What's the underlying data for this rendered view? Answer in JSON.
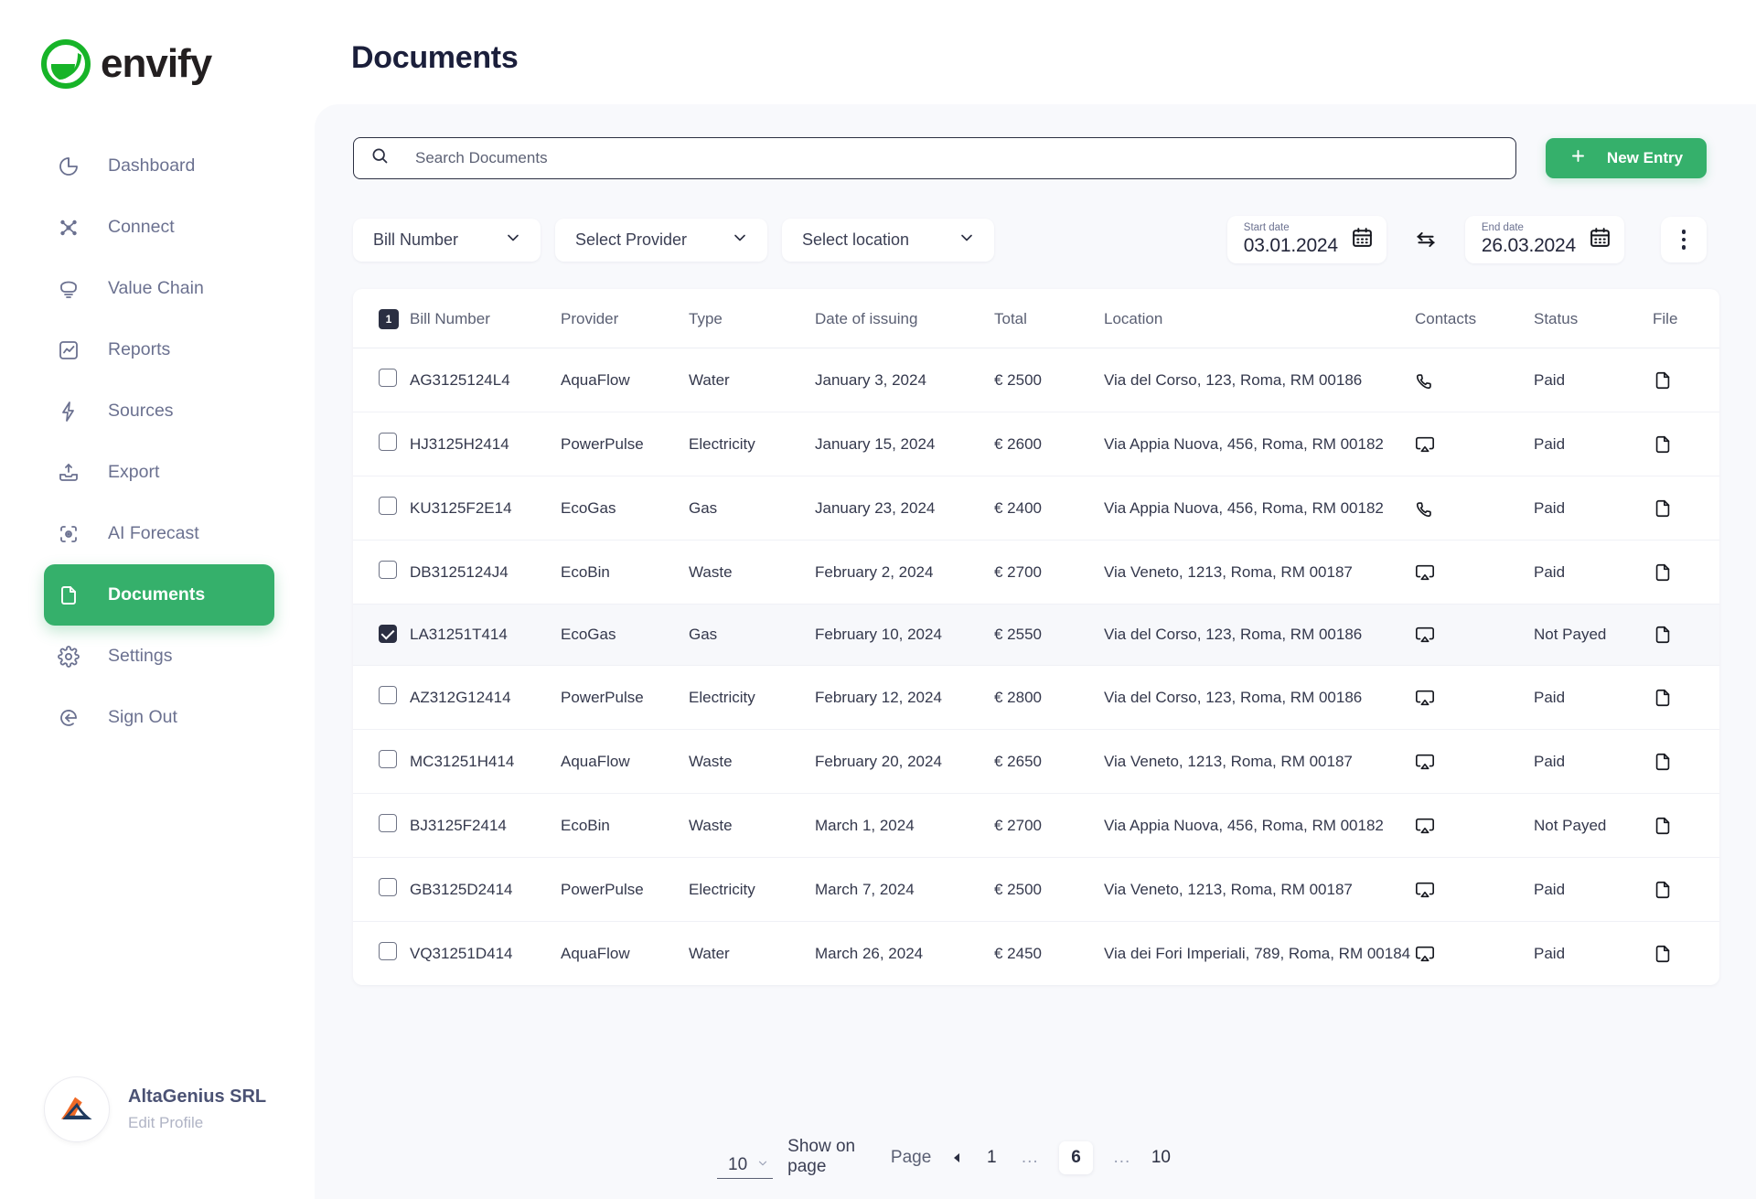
{
  "brand": {
    "name": "envify",
    "accent": "#35b06b"
  },
  "sidebar": {
    "items": [
      {
        "label": "Dashboard",
        "icon": "pie-chart-icon",
        "active": false
      },
      {
        "label": "Connect",
        "icon": "network-icon",
        "active": false
      },
      {
        "label": "Value Chain",
        "icon": "chain-link-icon",
        "active": false
      },
      {
        "label": "Reports",
        "icon": "report-icon",
        "active": false
      },
      {
        "label": "Sources",
        "icon": "bolt-icon",
        "active": false
      },
      {
        "label": "Export",
        "icon": "export-icon",
        "active": false
      },
      {
        "label": "AI Forecast",
        "icon": "scan-eye-icon",
        "active": false
      },
      {
        "label": "Documents",
        "icon": "document-icon",
        "active": true
      },
      {
        "label": "Settings",
        "icon": "gear-icon",
        "active": false
      },
      {
        "label": "Sign Out",
        "icon": "sign-out-icon",
        "active": false
      }
    ],
    "profile": {
      "name": "AltaGenius SRL",
      "link": "Edit Profile"
    }
  },
  "header": {
    "title": "Documents"
  },
  "search": {
    "placeholder": "Search Documents",
    "value": "",
    "icon": "search-icon"
  },
  "new_entry": {
    "label": "New Entry",
    "icon": "plus-icon"
  },
  "filters": {
    "bill_number": "Bill Number",
    "provider": "Select Provider",
    "location": "Select location",
    "start": {
      "label": "Start date",
      "value": "03.01.2024",
      "icon": "calendar-icon"
    },
    "end": {
      "label": "End date",
      "value": "26.03.2024",
      "icon": "calendar-icon"
    },
    "swap_icon": "swap-arrows-icon",
    "more_icon": "kebab-menu-icon"
  },
  "table": {
    "select_all_badge": "1",
    "columns": [
      "Bill Number",
      "Provider",
      "Type",
      "Date of issuing",
      "Total",
      "Location",
      "Contacts",
      "Status",
      "File"
    ],
    "rows": [
      {
        "checked": false,
        "bill": "AG3125124L4",
        "provider": "AquaFlow",
        "type": "Water",
        "date": "January 3, 2024",
        "total": "€ 2500",
        "location": "Via del Corso, 123, Roma, RM 00186",
        "contact_icon": "phone-icon",
        "status": "Paid",
        "file_icon": "file-icon"
      },
      {
        "checked": false,
        "bill": "HJ3125H2414",
        "provider": "PowerPulse",
        "type": "Electricity",
        "date": "January 15, 2024",
        "total": "€ 2600",
        "location": "Via Appia Nuova, 456, Roma, RM 00182",
        "contact_icon": "airplay-icon",
        "status": "Paid",
        "file_icon": "file-icon"
      },
      {
        "checked": false,
        "bill": "KU3125F2E14",
        "provider": "EcoGas",
        "type": "Gas",
        "date": "January 23, 2024",
        "total": "€ 2400",
        "location": "Via Appia Nuova, 456, Roma, RM 00182",
        "contact_icon": "phone-icon",
        "status": "Paid",
        "file_icon": "file-icon"
      },
      {
        "checked": false,
        "bill": "DB3125124J4",
        "provider": "EcoBin",
        "type": "Waste",
        "date": "February 2, 2024",
        "total": "€ 2700",
        "location": "Via Veneto, 1213, Roma, RM 00187",
        "contact_icon": "airplay-icon",
        "status": "Paid",
        "file_icon": "file-icon"
      },
      {
        "checked": true,
        "bill": "LA31251T414",
        "provider": "EcoGas",
        "type": "Gas",
        "date": "February 10, 2024",
        "total": "€ 2550",
        "location": "Via del Corso, 123, Roma, RM 00186",
        "contact_icon": "airplay-icon",
        "status": "Not Payed",
        "file_icon": "file-icon"
      },
      {
        "checked": false,
        "bill": "AZ312G12414",
        "provider": "PowerPulse",
        "type": "Electricity",
        "date": "February 12, 2024",
        "total": "€ 2800",
        "location": "Via del Corso, 123, Roma, RM 00186",
        "contact_icon": "airplay-icon",
        "status": "Paid",
        "file_icon": "file-icon"
      },
      {
        "checked": false,
        "bill": "MC31251H414",
        "provider": "AquaFlow",
        "type": "Waste",
        "date": "February 20, 2024",
        "total": "€ 2650",
        "location": "Via Veneto, 1213, Roma, RM 00187",
        "contact_icon": "airplay-icon",
        "status": "Paid",
        "file_icon": "file-icon"
      },
      {
        "checked": false,
        "bill": "BJ3125F2414",
        "provider": "EcoBin",
        "type": "Waste",
        "date": "March 1, 2024",
        "total": "€ 2700",
        "location": "Via Appia Nuova, 456, Roma, RM 00182",
        "contact_icon": "airplay-icon",
        "status": "Not Payed",
        "file_icon": "file-icon"
      },
      {
        "checked": false,
        "bill": "GB3125D2414",
        "provider": "PowerPulse",
        "type": "Electricity",
        "date": "March 7, 2024",
        "total": "€ 2500",
        "location": "Via Veneto, 1213, Roma, RM 00187",
        "contact_icon": "airplay-icon",
        "status": "Paid",
        "file_icon": "file-icon"
      },
      {
        "checked": false,
        "bill": "VQ31251D414",
        "provider": "AquaFlow",
        "type": "Water",
        "date": "March 26, 2024",
        "total": "€ 2450",
        "location": "Via dei Fori Imperiali, 789, Roma, RM 00184",
        "contact_icon": "airplay-icon",
        "status": "Paid",
        "file_icon": "file-icon"
      }
    ]
  },
  "footer": {
    "page_size": "10",
    "show_on_page": "Show on page",
    "page_label": "Page",
    "pages": [
      "1",
      "...",
      "6",
      "...",
      "10"
    ],
    "current_page": "6"
  }
}
